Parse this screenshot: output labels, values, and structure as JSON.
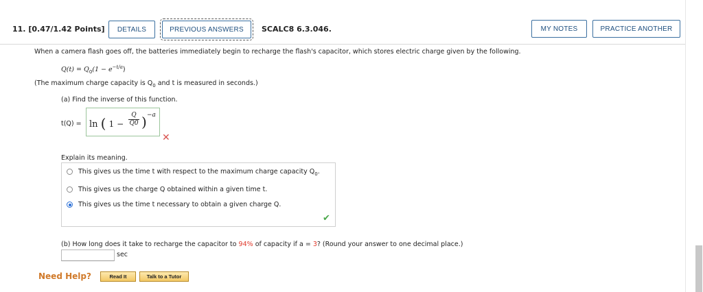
{
  "header": {
    "question_number": "11.",
    "points": "[0.47/1.42 Points]",
    "details_label": "DETAILS",
    "previous_answers_label": "PREVIOUS ANSWERS",
    "question_id": "SCALC8 6.3.046.",
    "my_notes_label": "MY NOTES",
    "practice_another_label": "PRACTICE ANOTHER"
  },
  "body": {
    "intro": "When a camera flash goes off, the batteries immediately begin to recharge the flash's capacitor, which stores electric charge given by the following.",
    "formula_lhs": "Q(t) = Q",
    "formula_sub": "0",
    "formula_rhs": "(1 − e",
    "formula_exp": "−t/a",
    "formula_close": ")",
    "note": "(The maximum charge capacity is Q",
    "note_sub": "0",
    "note_rest": " and t is measured in seconds.)",
    "part_a": "(a) Find the inverse of this function.",
    "answer_lhs": "t(Q) =",
    "answer_ln": "ln",
    "answer_one": "1 −",
    "answer_num": "Q",
    "answer_den": "Q0",
    "answer_exp": "−a",
    "explain_label": "Explain its meaning.",
    "option1": "This gives us the time t with respect to the maximum charge capacity Q",
    "option1_sub": "0",
    "option1_end": ".",
    "option2": "This gives us the charge Q obtained within a given time t.",
    "option3": "This gives us the time t necessary to obtain a given charge Q.",
    "part_b_pre": "(b) How long does it take to recharge the capacitor to ",
    "part_b_pct": "94%",
    "part_b_mid": " of capacity if a = ",
    "part_b_a": "3",
    "part_b_post": "? (Round your answer to one decimal place.)",
    "unit": "sec",
    "need_help": "Need Help?",
    "read_it": "Read It",
    "talk_tutor": "Talk to a Tutor"
  },
  "state": {
    "selected_option": 3,
    "part_a_result": "incorrect",
    "explain_result": "correct",
    "part_b_value": ""
  },
  "colors": {
    "accent": "#1d4e7e",
    "highlight_red": "#e0392b",
    "success": "#4aa84a",
    "error": "#d9534f",
    "help_orange": "#d07a2a"
  }
}
